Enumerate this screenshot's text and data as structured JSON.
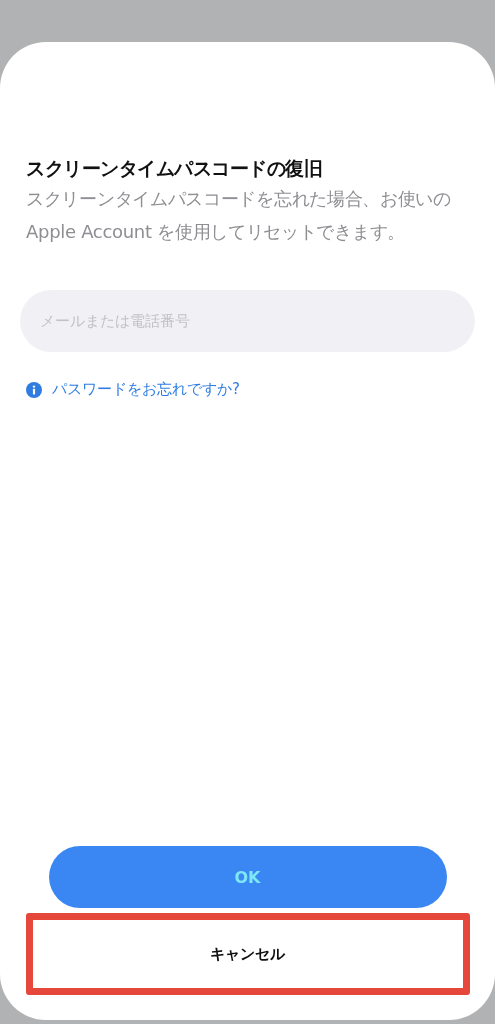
{
  "title": "スクリーンタイムパスコードの復旧",
  "description": "スクリーンタイムパスコードを忘れた場合、お使いの Apple Account を使用してリセットできます。",
  "field": {
    "placeholder": "メールまたは電話番号"
  },
  "help_link": {
    "label": "パスワードをお忘れですか?"
  },
  "buttons": [
    {
      "label": "OK",
      "kind": "primary"
    },
    {
      "label": "キャンセル",
      "kind": "secondary"
    }
  ]
}
